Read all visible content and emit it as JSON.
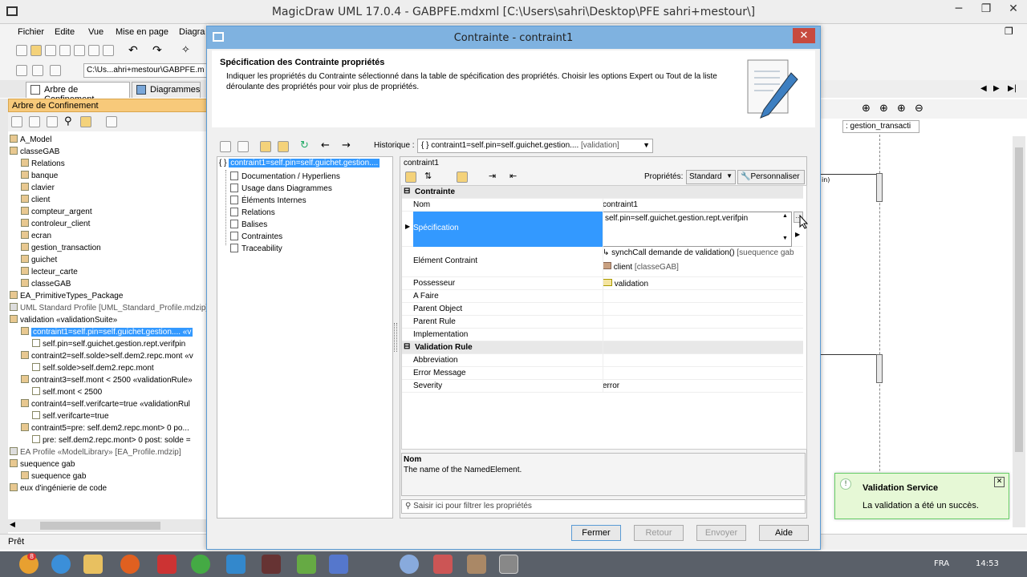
{
  "window": {
    "title": "MagicDraw UML 17.0.4 - GABPFE.mdxml [C:\\Users\\sahri\\Desktop\\PFE sahri+mestour\\]"
  },
  "menu": [
    "Fichier",
    "Edite",
    "Vue",
    "Mise en page",
    "Diagra"
  ],
  "path_field": "C:\\Us...ahri+mestour\\GABPFE.m",
  "left_tabs": {
    "containment": "Arbre de Confinement",
    "diagrams": "Diagrammes"
  },
  "tree_header": "Arbre de Confinement",
  "tree": [
    {
      "text": "A_Model",
      "indent": 0
    },
    {
      "text": "classeGAB",
      "indent": 0
    },
    {
      "text": "Relations",
      "indent": 1
    },
    {
      "text": "banque",
      "indent": 1
    },
    {
      "text": "clavier",
      "indent": 1
    },
    {
      "text": "client",
      "indent": 1
    },
    {
      "text": "compteur_argent",
      "indent": 1
    },
    {
      "text": "controleur_client",
      "indent": 1
    },
    {
      "text": "ecran",
      "indent": 1
    },
    {
      "text": "gestion_transaction",
      "indent": 1
    },
    {
      "text": "guichet",
      "indent": 1
    },
    {
      "text": "lecteur_carte",
      "indent": 1
    },
    {
      "text": "classeGAB",
      "indent": 1
    },
    {
      "text": "EA_PrimitiveTypes_Package",
      "indent": 0
    },
    {
      "text": "UML Standard Profile [UML_Standard_Profile.mdzip]",
      "indent": 0,
      "gray": true
    },
    {
      "text": "validation «validationSuite»",
      "indent": 0
    },
    {
      "text": "contraint1=self.pin=self.guichet.gestion.... «v",
      "indent": 1,
      "selected": true
    },
    {
      "text": "self.pin=self.guichet.gestion.rept.verifpin",
      "indent": 2
    },
    {
      "text": "contraint2=self.solde>self.dem2.repc.mont «v",
      "indent": 1
    },
    {
      "text": "self.solde>self.dem2.repc.mont",
      "indent": 2
    },
    {
      "text": "contraint3=self.mont < 2500 «validationRule»",
      "indent": 1
    },
    {
      "text": "self.mont < 2500",
      "indent": 2
    },
    {
      "text": "contraint4=self.verifcarte=true «validationRul",
      "indent": 1
    },
    {
      "text": "self.verifcarte=true",
      "indent": 2
    },
    {
      "text": "contraint5=pre: self.dem2.repc.mont> 0 po...",
      "indent": 1
    },
    {
      "text": "pre: self.dem2.repc.mont> 0 post: solde =",
      "indent": 2
    },
    {
      "text": "EA Profile «ModelLibrary» [EA_Profile.mdzip]",
      "indent": 0,
      "gray": true
    },
    {
      "text": "suequence gab",
      "indent": 0
    },
    {
      "text": "suequence gab",
      "indent": 1
    },
    {
      "text": "eux d'ingénierie de code",
      "indent": 0
    }
  ],
  "status": "Prêt",
  "dialog": {
    "title": "Contrainte - contraint1",
    "header_title": "Spécification des Contrainte propriétés",
    "header_desc": "Indiquer les propriétés du Contrainte sélectionné dans la table de spécification des propriétés. Choisir les options Expert ou Tout de la liste déroulante des propriétés pour voir plus de propriétés.",
    "history_label": "Historique :",
    "history_value": "{ } contraint1=self.pin=self.guichet.gestion....",
    "history_tag": "[validation]",
    "nav_selected": "contraint1=self.pin=self.guichet.gestion....",
    "nav_items": [
      "Documentation / Hyperliens",
      "Usage dans Diagrammes",
      "Éléments Internes",
      "Relations",
      "Balises",
      "Contraintes",
      "Traceability"
    ],
    "panel_title": "contraint1",
    "props_label": "Propriétés:",
    "props_value": "Standard",
    "customize": "Personnaliser",
    "section1": "Contrainte",
    "rows": [
      {
        "k": "Nom",
        "v": "contraint1"
      },
      {
        "k": "Spécification",
        "v": "self.pin=self.guichet.gestion.rept.verifpin"
      },
      {
        "k": "Elément Contraint",
        "v1": "synchCall demande de validation()",
        "v1b": "[suequence gab",
        "v2": "client",
        "v2b": "[classeGAB]"
      },
      {
        "k": "Possesseur",
        "v": "validation"
      },
      {
        "k": "A Faire",
        "v": ""
      },
      {
        "k": "Parent Object",
        "v": ""
      },
      {
        "k": "Parent Rule",
        "v": ""
      },
      {
        "k": "Implementation",
        "v": ""
      }
    ],
    "section2": "Validation Rule",
    "rows2": [
      {
        "k": "Abbreviation",
        "v": ""
      },
      {
        "k": "Error Message",
        "v": ""
      },
      {
        "k": "Severity",
        "v": "error"
      }
    ],
    "desc_title": "Nom",
    "desc_text": "The name of the NamedElement.",
    "filter_placeholder": "Saisir ici pour filtrer les propriétés",
    "buttons": {
      "close": "Fermer",
      "back": "Retour",
      "send": "Envoyer",
      "help": "Aide"
    }
  },
  "diagram": {
    "lifeline": ": gestion_transacti",
    "msg": "in)"
  },
  "notification": {
    "title": "Validation Service",
    "text": "La validation a été un succès."
  },
  "taskbar": {
    "lang": "FRA",
    "time": "14:53",
    "badge": "8"
  }
}
